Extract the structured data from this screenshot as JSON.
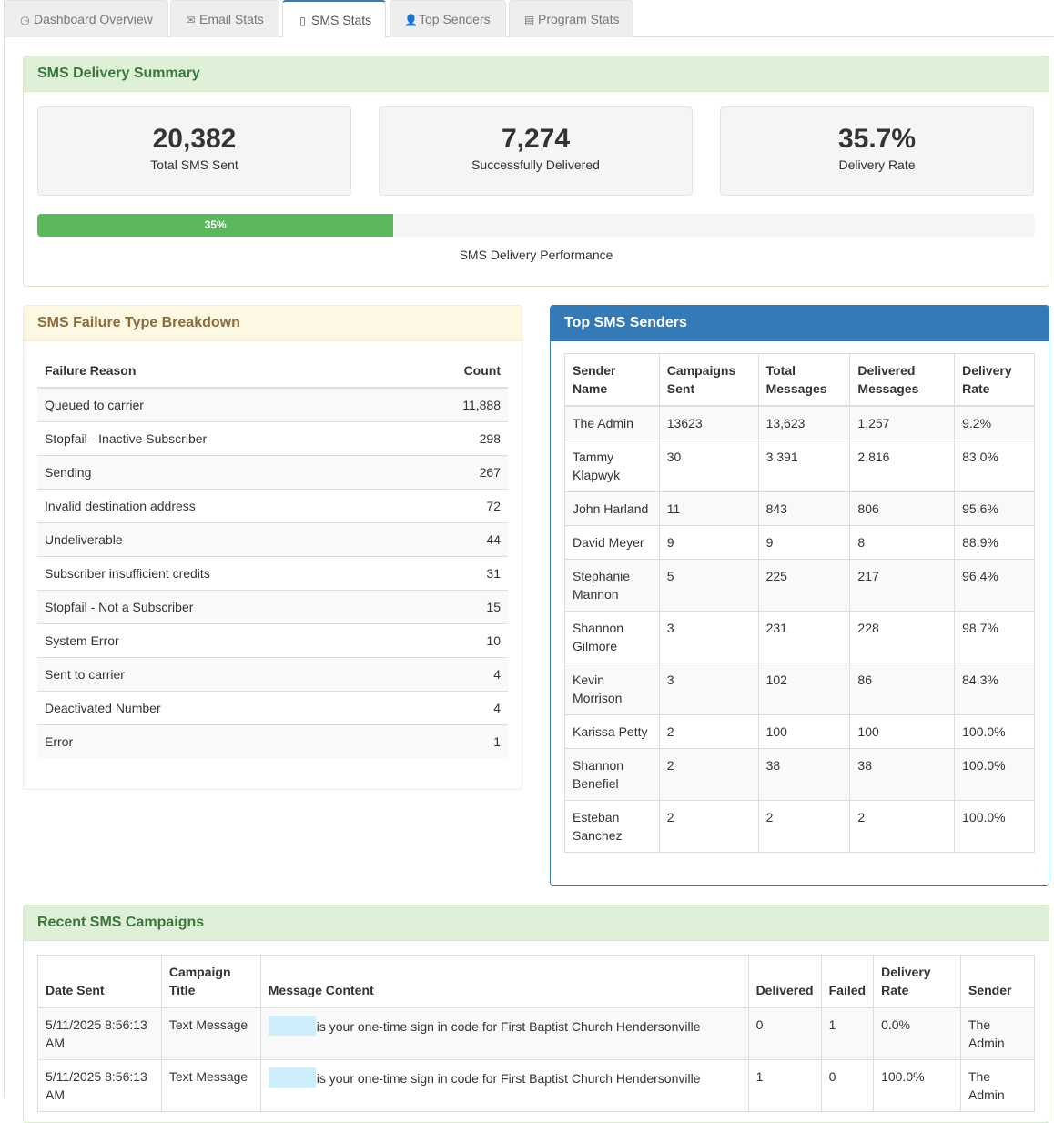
{
  "tabs": [
    {
      "label": "Dashboard Overview",
      "icon": "dashboard-icon",
      "glyph": "◷"
    },
    {
      "label": "Email Stats",
      "icon": "envelope-icon",
      "glyph": "✉"
    },
    {
      "label": "SMS Stats",
      "icon": "phone-icon",
      "glyph": "▯"
    },
    {
      "label": "Top Senders",
      "icon": "user-icon",
      "glyph": "👤"
    },
    {
      "label": "Program Stats",
      "icon": "list-icon",
      "glyph": "▤"
    }
  ],
  "summary": {
    "title": "SMS Delivery Summary",
    "total_sent": {
      "value": "20,382",
      "label": "Total SMS Sent"
    },
    "delivered": {
      "value": "7,274",
      "label": "Successfully Delivered"
    },
    "rate": {
      "value": "35.7%",
      "label": "Delivery Rate"
    },
    "progress_label": "35%",
    "progress_percent": 35.7,
    "progress_caption": "SMS Delivery Performance",
    "bar_color": "#5cb85c"
  },
  "failures": {
    "title": "SMS Failure Type Breakdown",
    "headers": [
      "Failure Reason",
      "Count"
    ],
    "rows": [
      [
        "Queued to carrier",
        "11,888"
      ],
      [
        "Stopfail - Inactive Subscriber",
        "298"
      ],
      [
        "Sending",
        "267"
      ],
      [
        "Invalid destination address",
        "72"
      ],
      [
        "Undeliverable",
        "44"
      ],
      [
        "Subscriber insufficient credits",
        "31"
      ],
      [
        "Stopfail - Not a Subscriber",
        "15"
      ],
      [
        "System Error",
        "10"
      ],
      [
        "Sent to carrier",
        "4"
      ],
      [
        "Deactivated Number",
        "4"
      ],
      [
        "Error",
        "1"
      ]
    ]
  },
  "senders": {
    "title": "Top SMS Senders",
    "headers": [
      "Sender\nName",
      "Campaigns\nSent",
      "Total\nMessages",
      "Delivered\nMessages",
      "Delivery\nRate"
    ],
    "rows": [
      [
        "The Admin",
        "13623",
        "13,623",
        "1,257",
        "9.2%"
      ],
      [
        "Tammy Klapwyk",
        "30",
        "3,391",
        "2,816",
        "83.0%"
      ],
      [
        "John Harland",
        "11",
        "843",
        "806",
        "95.6%"
      ],
      [
        "David Meyer",
        "9",
        "9",
        "8",
        "88.9%"
      ],
      [
        "Stephanie Mannon",
        "5",
        "225",
        "217",
        "96.4%"
      ],
      [
        "Shannon Gilmore",
        "3",
        "231",
        "228",
        "98.7%"
      ],
      [
        "Kevin Morrison",
        "3",
        "102",
        "86",
        "84.3%"
      ],
      [
        "Karissa Petty",
        "2",
        "100",
        "100",
        "100.0%"
      ],
      [
        "Shannon Benefiel",
        "2",
        "38",
        "38",
        "100.0%"
      ],
      [
        "Esteban Sanchez",
        "2",
        "2",
        "2",
        "100.0%"
      ]
    ]
  },
  "campaigns": {
    "title": "Recent SMS Campaigns",
    "headers": [
      "Date Sent",
      "Campaign Title",
      "Message Content",
      "Delivered",
      "Failed",
      "Delivery Rate",
      "Sender"
    ],
    "rows": [
      [
        "5/11/2025 8:56:13 AM",
        "Text Message",
        "is your one-time sign in code for First Baptist Church Hendersonville",
        "0",
        "1",
        "0.0%",
        "The Admin"
      ],
      [
        "5/11/2025 8:56:13 AM",
        "Text Message",
        "is your one-time sign in code for First Baptist Church Hendersonville",
        "1",
        "0",
        "100.0%",
        "The Admin"
      ]
    ]
  }
}
